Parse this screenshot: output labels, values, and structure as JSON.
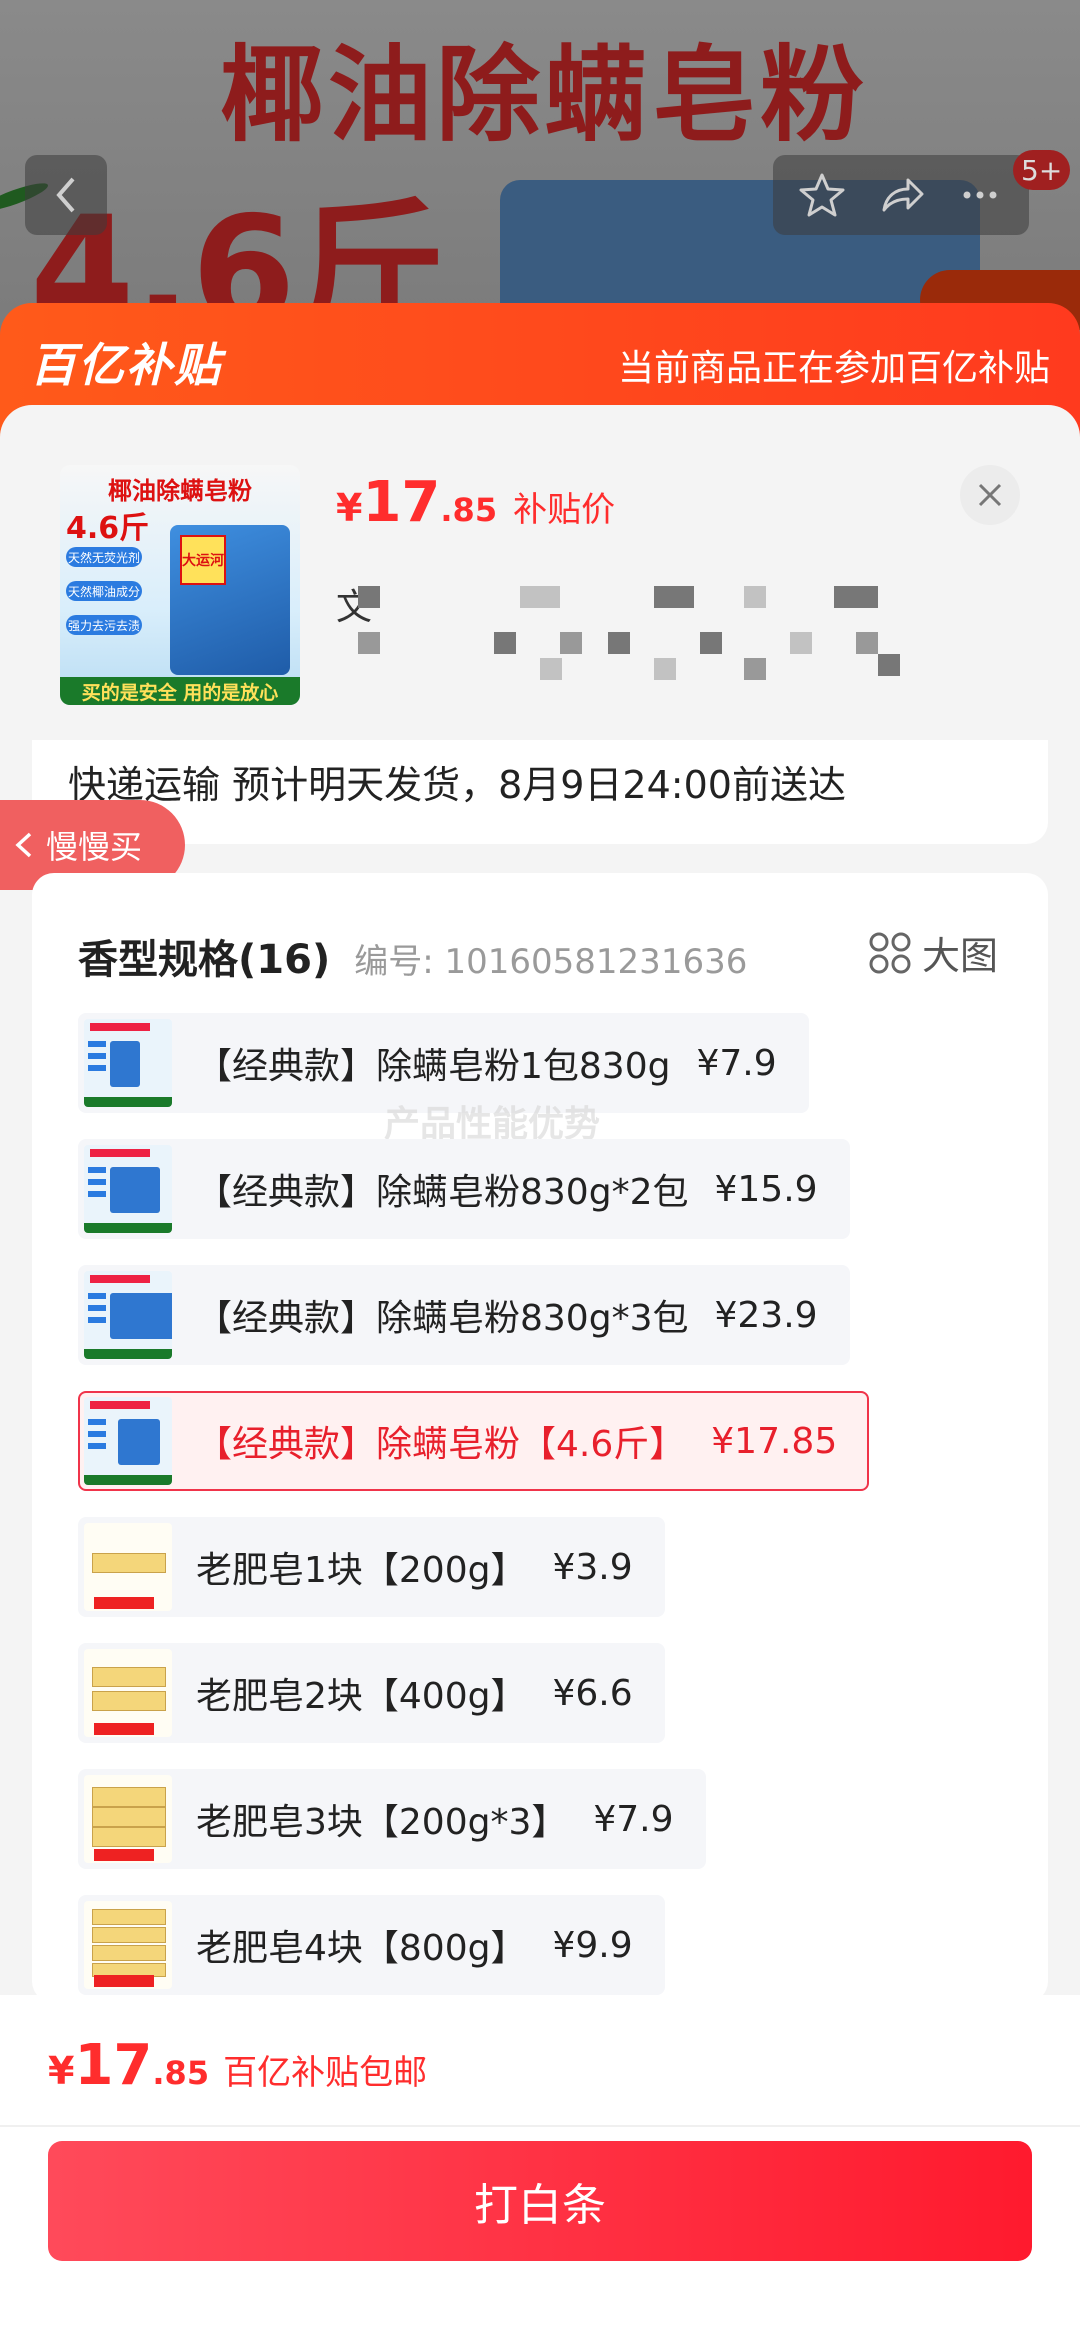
{
  "background": {
    "title_text": "椰油除螨皂粉",
    "weight_text": "4.6斤"
  },
  "nav": {
    "more_badge": "5+"
  },
  "subsidy": {
    "logo": "百亿补贴",
    "tagline": "当前商品正在参加百亿补贴"
  },
  "product": {
    "image_title": "椰油除螨皂粉",
    "image_weight": "4.6斤",
    "image_chips": [
      "天然无荧光剂",
      "天然椰油成分",
      "强力去污去渍"
    ],
    "image_bag_label": "大运河",
    "image_strip": "买的是安全 用的是放心",
    "price_symbol": "¥",
    "price_int": "17",
    "price_dec": ".85",
    "price_tag": "补贴价",
    "blurred_prefix": "文"
  },
  "shipping": {
    "text": "快递运输 预计明天发货，8月9日24:00前送达"
  },
  "slow_buy": {
    "label": "慢慢买"
  },
  "spec": {
    "title": "香型规格(16)",
    "code": "编号: 10160581231636",
    "view_big": "大图",
    "watermark": "产品性能优势",
    "options": [
      {
        "label": "【经典款】除螨皂粉1包830g",
        "price": "¥7.9",
        "selected": false,
        "kind": "bag"
      },
      {
        "label": "【经典款】除螨皂粉830g*2包",
        "price": "¥15.9",
        "selected": false,
        "kind": "bag"
      },
      {
        "label": "【经典款】除螨皂粉830g*3包",
        "price": "¥23.9",
        "selected": false,
        "kind": "bag"
      },
      {
        "label": "【经典款】除螨皂粉【4.6斤】",
        "price": "¥17.85",
        "selected": true,
        "kind": "bag"
      },
      {
        "label": "老肥皂1块【200g】",
        "price": "¥3.9",
        "selected": false,
        "kind": "soap"
      },
      {
        "label": "老肥皂2块【400g】",
        "price": "¥6.6",
        "selected": false,
        "kind": "soap"
      },
      {
        "label": "老肥皂3块【200g*3】",
        "price": "¥7.9",
        "selected": false,
        "kind": "soap"
      },
      {
        "label": "老肥皂4块【800g】",
        "price": "¥9.9",
        "selected": false,
        "kind": "soap"
      }
    ]
  },
  "bottom": {
    "price_symbol": "¥",
    "price_int": "17",
    "price_dec": ".85",
    "note": "百亿补贴包邮",
    "buy_label": "打白条"
  },
  "colors": {
    "accent": "#ff2d2d",
    "subsidy": "#ff4a1a",
    "selected_border": "#f0344a"
  },
  "icons": [
    "back-arrow-icon",
    "star-icon",
    "share-icon",
    "more-icon",
    "close-icon",
    "chevron-left-icon",
    "grid-icon"
  ]
}
